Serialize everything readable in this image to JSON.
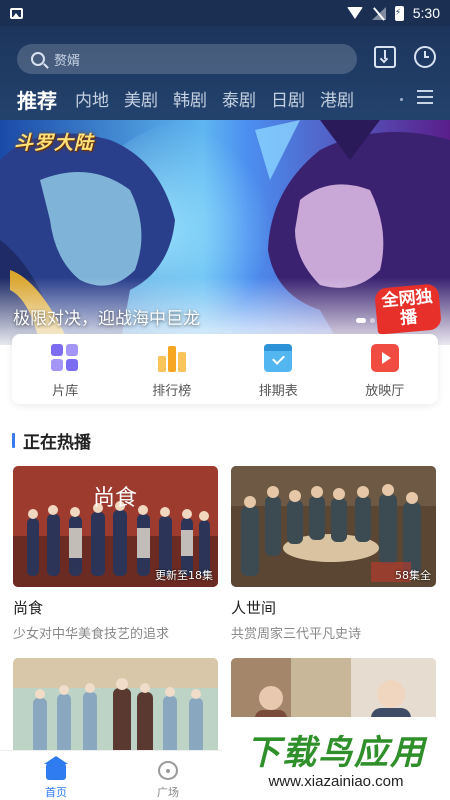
{
  "status_bar": {
    "time": "5:30"
  },
  "search": {
    "placeholder": "赘婿"
  },
  "tabs": [
    "推荐",
    "内地",
    "美剧",
    "韩剧",
    "泰剧",
    "日剧",
    "港剧"
  ],
  "banner": {
    "logo_text": "斗罗大陆",
    "caption": "极限对决，迎战海中巨龙",
    "badge": "全网独播"
  },
  "quick_entries": [
    {
      "label": "片库",
      "icon": "library-grid-icon"
    },
    {
      "label": "排行榜",
      "icon": "ranking-bars-icon"
    },
    {
      "label": "排期表",
      "icon": "schedule-calendar-icon"
    },
    {
      "label": "放映厅",
      "icon": "cinema-play-icon"
    }
  ],
  "section": {
    "title": "正在热播"
  },
  "cards": [
    {
      "title": "尚食",
      "subtitle": "少女对中华美食技艺的追求",
      "episodes": "更新至18集",
      "logo": "尚食"
    },
    {
      "title": "人世间",
      "subtitle": "共赏周家三代平凡史诗",
      "episodes": "58集全"
    }
  ],
  "bottom_nav": [
    {
      "label": "首页",
      "icon": "home-icon",
      "active": true
    },
    {
      "label": "广场",
      "icon": "plaza-icon",
      "active": false
    }
  ],
  "watermark": {
    "title": "下载鸟应用",
    "url": "www.xiazainiao.com"
  },
  "colors": {
    "header": "#1d355c",
    "accent": "#2f7bf0",
    "badge": "#e8302a"
  }
}
